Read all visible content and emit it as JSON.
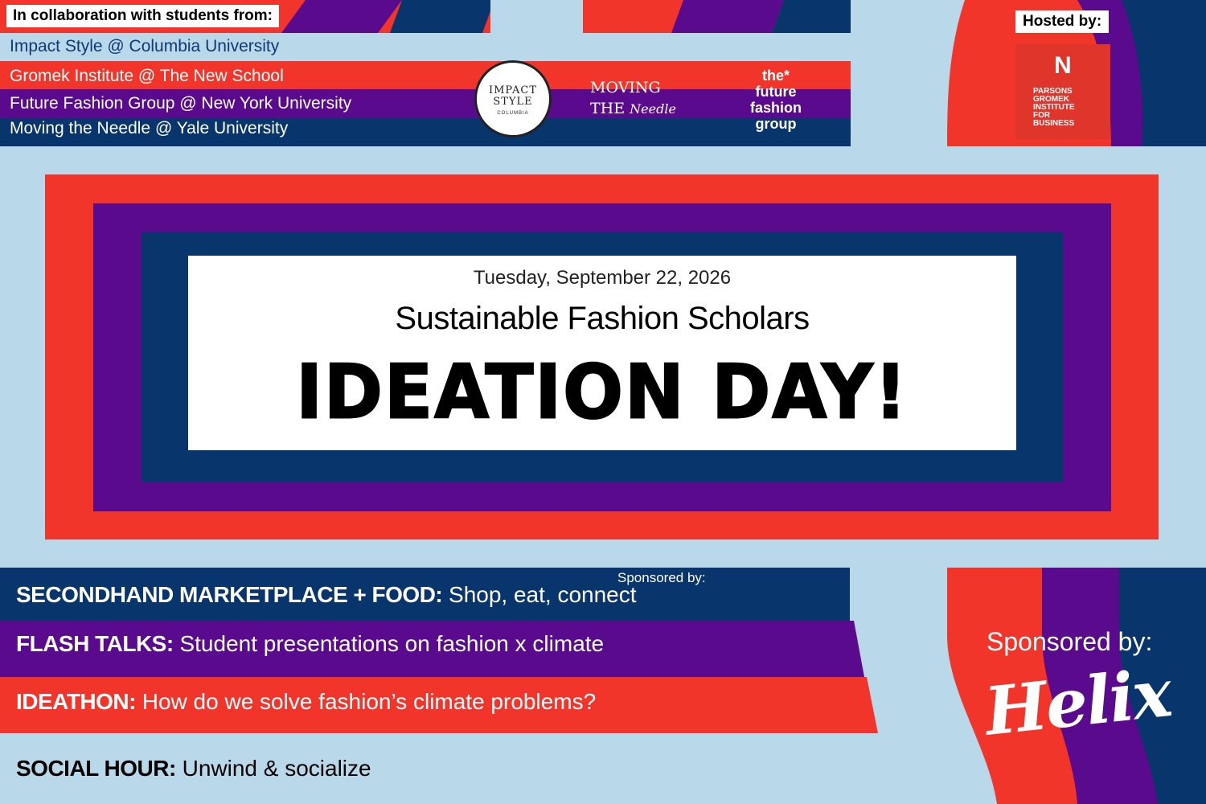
{
  "colors": {
    "background": "#b9d8ea",
    "navy": "#08356b",
    "purple": "#5a0a8c",
    "red": "#f2352a",
    "white": "#ffffff"
  },
  "collaboration": {
    "label": "In collaboration with students from:",
    "groups": [
      "Impact Style @ Columbia University",
      "Gromek Institute @ The New School",
      "Future Fashion Group @ New York University",
      "Moving the Needle @ Yale University"
    ]
  },
  "logos": {
    "impact_style": {
      "line1": "IMPACT",
      "line2": "STYLE",
      "line3": "COLUMBIA"
    },
    "moving_the_needle": {
      "line1": "MOVING",
      "line2": "THE",
      "script": "Needle"
    },
    "future_fashion_group": {
      "line1": "the*",
      "line2": "future",
      "line3": "fashion",
      "line4": "group"
    }
  },
  "host": {
    "label": "Hosted by:",
    "logo_letter": "N",
    "logo_lines": [
      "PARSONS",
      "GROMEK",
      "INSTITUTE",
      "FOR",
      "BUSINESS"
    ]
  },
  "event": {
    "date": "Tuesday, September 22, 2026",
    "subtitle": "Sustainable Fashion Scholars",
    "title": "IDEATION DAY!"
  },
  "schedule": [
    {
      "heading": "SECONDHAND MARKETPLACE  + FOOD:",
      "description": "Shop, eat, connect"
    },
    {
      "heading": "FLASH TALKS:",
      "description": "Student presentations on fashion x climate"
    },
    {
      "heading": "IDEATHON:",
      "description": "How do we solve fashion’s climate problems?"
    },
    {
      "heading": "SOCIAL HOUR:",
      "description": "Unwind & socialize"
    }
  ],
  "marketplace_sponsor_label": "Sponsored by:",
  "sponsor": {
    "label": "Sponsored by:",
    "name": "Helix"
  }
}
